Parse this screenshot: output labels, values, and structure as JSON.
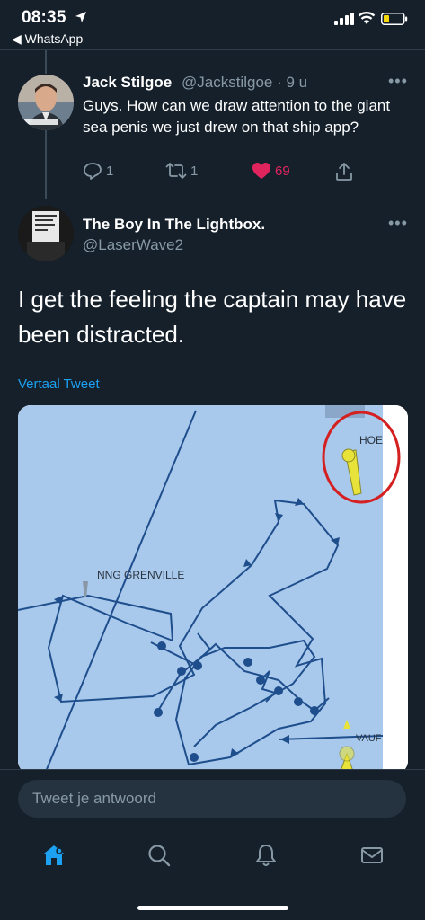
{
  "status_bar": {
    "time": "08:35",
    "back_app": "◀ WhatsApp"
  },
  "tweet1": {
    "name": "Jack Stilgoe",
    "handle_time": "@Jackstilgoe · 9 u",
    "text": "Guys. How can we draw attention to the giant sea penis we just drew on that ship app?",
    "replies": "1",
    "retweets": "1",
    "likes": "69",
    "liked": true,
    "like_color": "#e0245e"
  },
  "tweet2": {
    "name": "The Boy In The Lightbox.",
    "handle": "@LaserWave2",
    "text": "I get the feeling the captain may have been distracted.",
    "translate": "Vertaal Tweet"
  },
  "map_image": {
    "labels": {
      "ship_left": "NNG GRENVILLE",
      "ship_top_right": "HOE",
      "ship_bottom_right": "VAUF"
    },
    "water_color": "#a8c8ec",
    "track_color": "#1f4e8c",
    "highlight_circle_color": "#d42020"
  },
  "reply_bar": {
    "placeholder": "Tweet je antwoord"
  },
  "tabs": {
    "active": "home",
    "accent": "#1da1f2"
  }
}
